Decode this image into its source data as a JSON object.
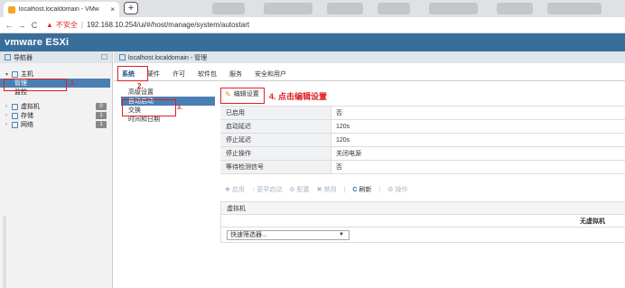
{
  "browser": {
    "tab_title": "localhost.localdomain - VMw",
    "tab_close": "×",
    "new_tab": "+",
    "nav_back": "←",
    "nav_forward": "→",
    "nav_reload": "C",
    "warning_icon": "▲",
    "insecure_label": "不安全",
    "separator": "|",
    "url": "192.168.10.254/ui/#/host/manage/system/autostart"
  },
  "header": {
    "logo": "vmware ESXi"
  },
  "navigator": {
    "title": "导航器",
    "items": [
      {
        "label": "主机",
        "expand": "▾"
      },
      {
        "label": "管理",
        "selected": true
      },
      {
        "label": "监控"
      },
      {
        "label": "虚拟机",
        "expand": "›",
        "count": "0"
      },
      {
        "label": "存储",
        "expand": "›",
        "count": "1"
      },
      {
        "label": "网络",
        "expand": "›",
        "count": "1"
      }
    ]
  },
  "annotations": {
    "a1": "1.",
    "a2": "2.",
    "a3": "3.",
    "a4": "4. 点击编辑设置"
  },
  "main": {
    "title": "localhost.localdomain - 管理",
    "tabs": [
      "系统",
      "硬件",
      "许可",
      "软件包",
      "服务",
      "安全和用户"
    ],
    "subnav": [
      "高级设置",
      "自动启动",
      "交换",
      "时间和日期"
    ],
    "edit_label": "编辑设置",
    "settings": [
      {
        "key": "已启用",
        "value": "否"
      },
      {
        "key": "启动延迟",
        "value": "120s"
      },
      {
        "key": "停止延迟",
        "value": "120s"
      },
      {
        "key": "停止操作",
        "value": "关闭电源"
      },
      {
        "key": "等待检测信号",
        "value": "否"
      }
    ],
    "toolbar": [
      {
        "label": "启用",
        "icon": "✚",
        "enabled": false
      },
      {
        "label": "更早启动",
        "icon": "↑",
        "enabled": false
      },
      {
        "label": "配置",
        "icon": "⚙",
        "enabled": false
      },
      {
        "label": "禁用",
        "icon": "✖",
        "enabled": false
      },
      {
        "label": "刷新",
        "icon": "C",
        "enabled": true
      },
      {
        "label": "操作",
        "icon": "⚙",
        "enabled": false
      }
    ],
    "vm_table": {
      "header": "虚拟机",
      "empty": "无虚拟机",
      "filter_placeholder": "快速筛选器...",
      "caret": "▼"
    }
  }
}
